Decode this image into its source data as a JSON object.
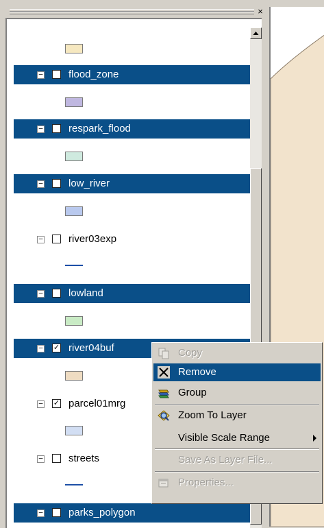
{
  "layers": [
    {
      "name": "flood_zone",
      "checked": false,
      "selected": true,
      "swatch": "#bfb7e0"
    },
    {
      "name": "respark_flood",
      "checked": false,
      "selected": true,
      "swatch": "#cfeadf"
    },
    {
      "name": "low_river",
      "checked": false,
      "selected": true,
      "swatch": "#b9c9ee"
    },
    {
      "name": "river03exp",
      "checked": false,
      "selected": false,
      "swatch": "line"
    },
    {
      "name": "lowland",
      "checked": false,
      "selected": true,
      "swatch": "#c9ebc5"
    },
    {
      "name": "river04buf",
      "checked": true,
      "selected": true,
      "swatch": "#efdcc2"
    },
    {
      "name": "parcel01mrg",
      "checked": true,
      "selected": false,
      "swatch": "#d2def3"
    },
    {
      "name": "streets",
      "checked": false,
      "selected": false,
      "swatch": "line"
    },
    {
      "name": "parks_polygon",
      "checked": false,
      "selected": true,
      "swatch": ""
    }
  ],
  "top_swatch": "#f6e8c0",
  "context_menu": {
    "items": [
      {
        "label": "Copy",
        "icon": "copy-icon",
        "enabled": false
      },
      {
        "label": "Remove",
        "icon": "remove-x-icon",
        "enabled": true,
        "highlighted": true
      },
      {
        "label": "Group",
        "icon": "group-icon",
        "enabled": true
      },
      {
        "label": "Zoom To Layer",
        "icon": "zoom-to-layer-icon",
        "enabled": true
      },
      {
        "label": "Visible Scale Range",
        "icon": "",
        "enabled": true,
        "submenu": true
      },
      {
        "label": "Save As Layer File...",
        "icon": "",
        "enabled": false
      },
      {
        "label": "Properties...",
        "icon": "properties-icon",
        "enabled": false
      }
    ]
  },
  "colors": {
    "selection": "#0a4f88",
    "map_fill": "#f2e3cc",
    "window": "#d4d0c8"
  },
  "symbols": {
    "collapse": "⊟",
    "check": "✓",
    "close": "×"
  }
}
